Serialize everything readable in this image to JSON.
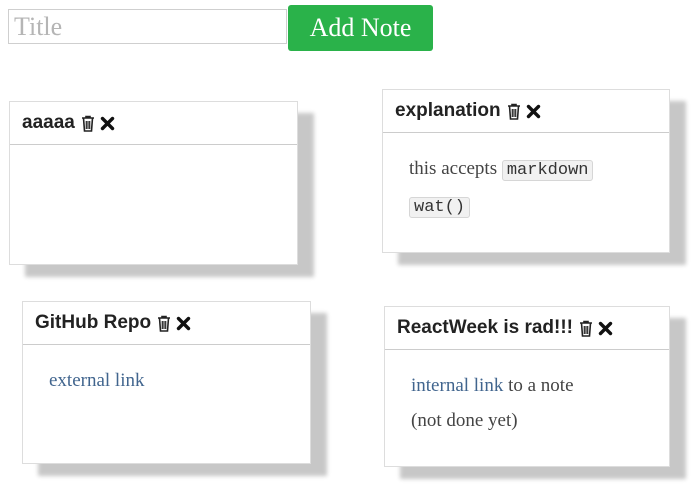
{
  "colors": {
    "accent": "#2ab24a",
    "link": "#41658e"
  },
  "toolbar": {
    "title_placeholder": "Title",
    "add_label": "Add Note"
  },
  "notes": [
    {
      "title": "aaaaa",
      "body": "",
      "icons": [
        "trash-icon",
        "close-icon"
      ]
    },
    {
      "title": "explanation",
      "body_text": "this accepts",
      "code_1": "markdown",
      "code_2": "wat()",
      "icons": [
        "trash-icon",
        "close-icon"
      ]
    },
    {
      "title": "GitHub Repo",
      "link_text": "external link",
      "icons": [
        "trash-icon",
        "close-icon"
      ]
    },
    {
      "title": "ReactWeek is rad!!!",
      "link_text": "internal link",
      "after_link": "to a note",
      "line_2": "(not done yet)",
      "icons": [
        "trash-icon",
        "close-icon"
      ]
    }
  ]
}
